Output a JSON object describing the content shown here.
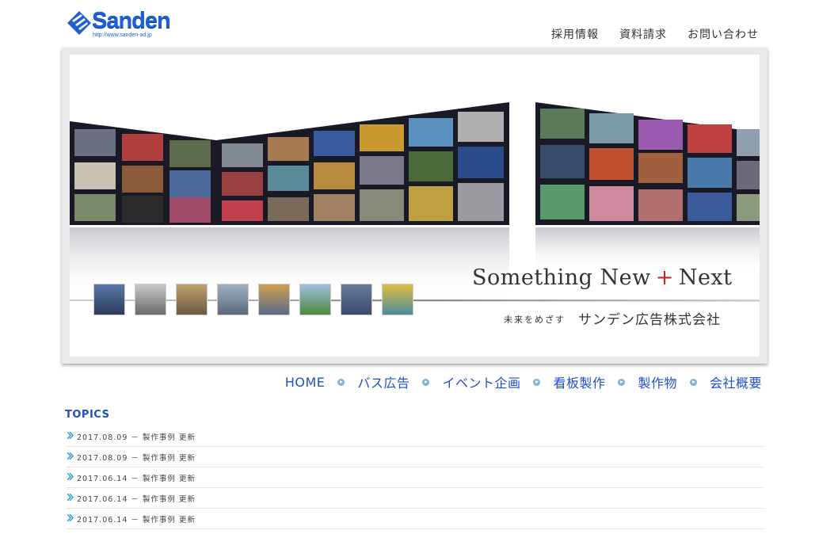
{
  "header": {
    "logo_text": "Sanden",
    "logo_url": "http://www.sanden-ad.jp",
    "nav": [
      "採用情報",
      "資料請求",
      "お問い合わせ"
    ]
  },
  "hero": {
    "slogan_left": "Something New",
    "slogan_plus": "+",
    "slogan_right": "Next",
    "tagline": "未来をめざす",
    "company": "サンデン広告株式会社",
    "thumbnail_count": 8
  },
  "main_nav": [
    "HOME",
    "バス広告",
    "イベント企画",
    "看板製作",
    "製作物",
    "会社概要"
  ],
  "topics": {
    "title": "TOPICS",
    "items": [
      "2017.08.09 － 製作事例 更新",
      "2017.08.09 － 製作事例 更新",
      "2017.06.14 － 製作事例 更新",
      "2017.06.14 － 製作事例 更新",
      "2017.06.14 － 製作事例 更新"
    ]
  },
  "colors": {
    "brand_blue": "#1f5fd1",
    "nav_blue": "#1f4fc9",
    "accent_red": "#d02020",
    "nav_dot": "#7fb3d9"
  }
}
